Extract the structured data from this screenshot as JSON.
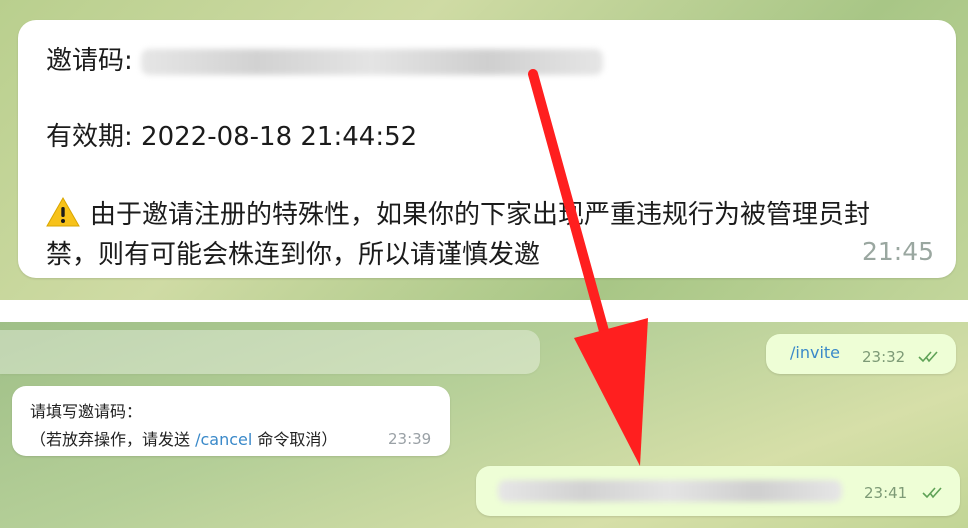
{
  "main_message": {
    "invite_code_label": "邀请码:",
    "expiry_line": "有效期: 2022-08-18 21:44:52",
    "warning_line1": "由于邀请注册的特殊性，如果你的下家出现严重违规行为被管理员封",
    "warning_line2": "禁，则有可能会株连到你，所以请谨慎发邀",
    "time": "21:45"
  },
  "outgoing_invite": {
    "command": "/invite",
    "time": "23:32"
  },
  "bot_prompt": {
    "line1": "请填写邀请码：",
    "line2_prefix": "（若放弃操作，请发送",
    "cancel_command": "/cancel",
    "line2_suffix": "命令取消）",
    "time": "23:39"
  },
  "outgoing_code": {
    "time": "23:41"
  },
  "colors": {
    "arrow": "#ff1f1f",
    "link": "#3a89c9",
    "outgoing_bubble": "#eefed6"
  }
}
